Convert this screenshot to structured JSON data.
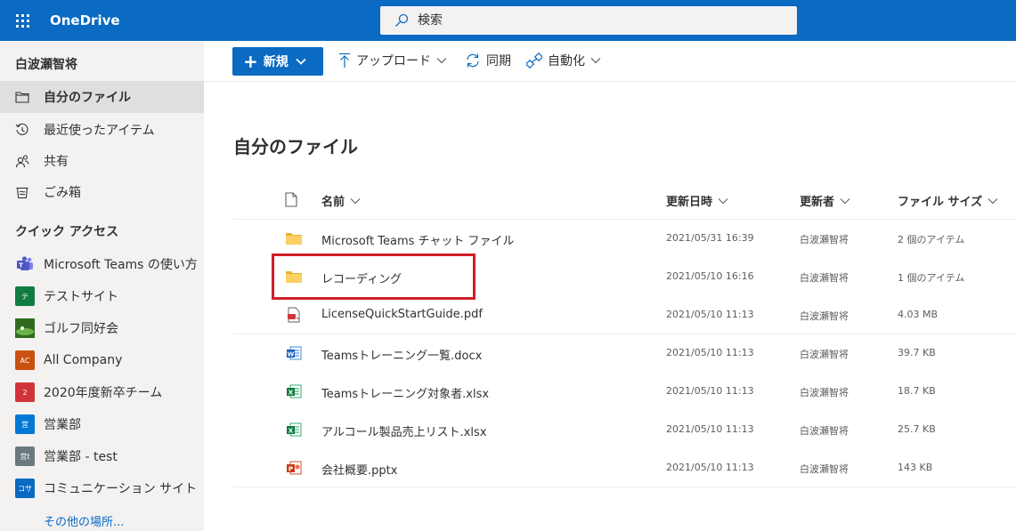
{
  "suite": {
    "app_name": "OneDrive",
    "search_placeholder": "検索",
    "accent": "#0b6ac1"
  },
  "nav": {
    "user": "白波瀬智将",
    "items": [
      {
        "label": "自分のファイル",
        "icon": "folder-icon",
        "active": true
      },
      {
        "label": "最近使ったアイテム",
        "icon": "history-icon",
        "active": false
      },
      {
        "label": "共有",
        "icon": "people-icon",
        "active": false
      },
      {
        "label": "ごみ箱",
        "icon": "trash-icon",
        "active": false
      }
    ],
    "quick_access_title": "クイック アクセス",
    "sites": [
      {
        "label": "Microsoft Teams の使い方",
        "logo_text": "",
        "color": "#4b53bc"
      },
      {
        "label": "テストサイト",
        "logo_text": "テ",
        "color": "#107c41"
      },
      {
        "label": "ゴルフ同好会",
        "logo_text": "",
        "color": "#3a7d22"
      },
      {
        "label": "All Company",
        "logo_text": "AC",
        "color": "#ca5010"
      },
      {
        "label": "2020年度新卒チーム",
        "logo_text": "2",
        "color": "#d13438"
      },
      {
        "label": "営業部",
        "logo_text": "営",
        "color": "#0078d4"
      },
      {
        "label": "営業部 - test",
        "logo_text": "営t",
        "color": "#69797e"
      },
      {
        "label": "コミュニケーション サイト",
        "logo_text": "コサ",
        "color": "#0b6ac1"
      }
    ],
    "more_places": "その他の場所..."
  },
  "commands": {
    "new": "新規",
    "upload": "アップロード",
    "sync": "同期",
    "automate": "自動化"
  },
  "main": {
    "title": "自分のファイル",
    "columns": {
      "name": "名前",
      "modified": "更新日時",
      "modified_by": "更新者",
      "size": "ファイル サイズ"
    },
    "files": [
      {
        "name": "Microsoft Teams チャット ファイル",
        "type": "folder",
        "date": "2021/05/31 16:39",
        "by": "白波瀬智将",
        "size": "2 個のアイテム"
      },
      {
        "name": "レコーディング",
        "type": "folder",
        "date": "2021/05/10 16:16",
        "by": "白波瀬智将",
        "size": "1 個のアイテム"
      },
      {
        "name": "LicenseQuickStartGuide.pdf",
        "type": "pdf",
        "date": "2021/05/10 11:13",
        "by": "白波瀬智将",
        "size": "4.03 MB"
      },
      {
        "name": "Teamsトレーニング一覧.docx",
        "type": "docx",
        "date": "2021/05/10 11:13",
        "by": "白波瀬智将",
        "size": "39.7 KB"
      },
      {
        "name": "Teamsトレーニング対象者.xlsx",
        "type": "xlsx",
        "date": "2021/05/10 11:13",
        "by": "白波瀬智将",
        "size": "18.7 KB"
      },
      {
        "name": "アルコール製品売上リスト.xlsx",
        "type": "xlsx",
        "date": "2021/05/10 11:13",
        "by": "白波瀬智将",
        "size": "25.7 KB"
      },
      {
        "name": "会社概要.pptx",
        "type": "pptx",
        "date": "2021/05/10 11:13",
        "by": "白波瀬智将",
        "size": "143 KB"
      }
    ]
  }
}
